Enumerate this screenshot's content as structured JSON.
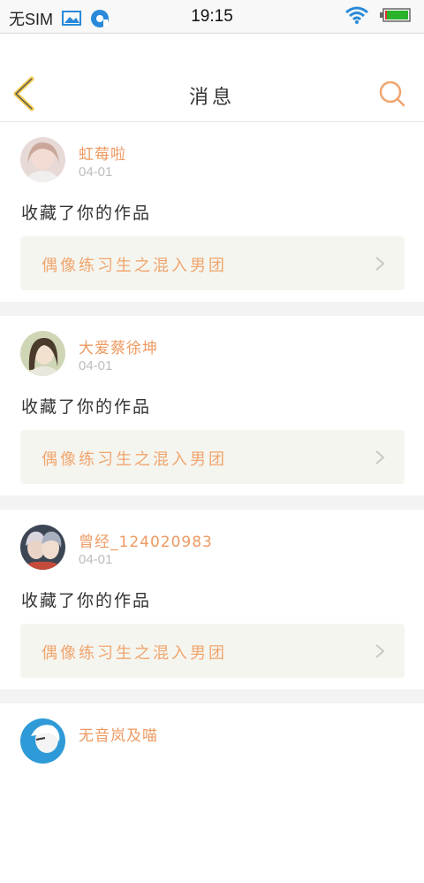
{
  "status_bar": {
    "carrier": "无SIM",
    "time": "19:15",
    "icons": [
      "image-icon",
      "notification-badge-icon",
      "wifi-icon",
      "battery-charging-icon"
    ]
  },
  "header": {
    "title": "消息",
    "back_icon": "chevron-left-icon",
    "search_icon": "search-icon"
  },
  "messages": [
    {
      "username": "虹莓啦",
      "date": "04-01",
      "action": "收藏了你的作品",
      "work_title": "偶像练习生之混入男团"
    },
    {
      "username": "大爱蔡徐坤",
      "date": "04-01",
      "action": "收藏了你的作品",
      "work_title": "偶像练习生之混入男团"
    },
    {
      "username": "曾经_124020983",
      "date": "04-01",
      "action": "收藏了你的作品",
      "work_title": "偶像练习生之混入男团"
    },
    {
      "username": "无音岚及喵",
      "date": "",
      "action": "",
      "work_title": ""
    }
  ],
  "colors": {
    "accent": "#ee9a62",
    "back_chevron": "#f2c94c",
    "work_bg": "#f5f5ef",
    "separator": "#f3f3f3"
  }
}
